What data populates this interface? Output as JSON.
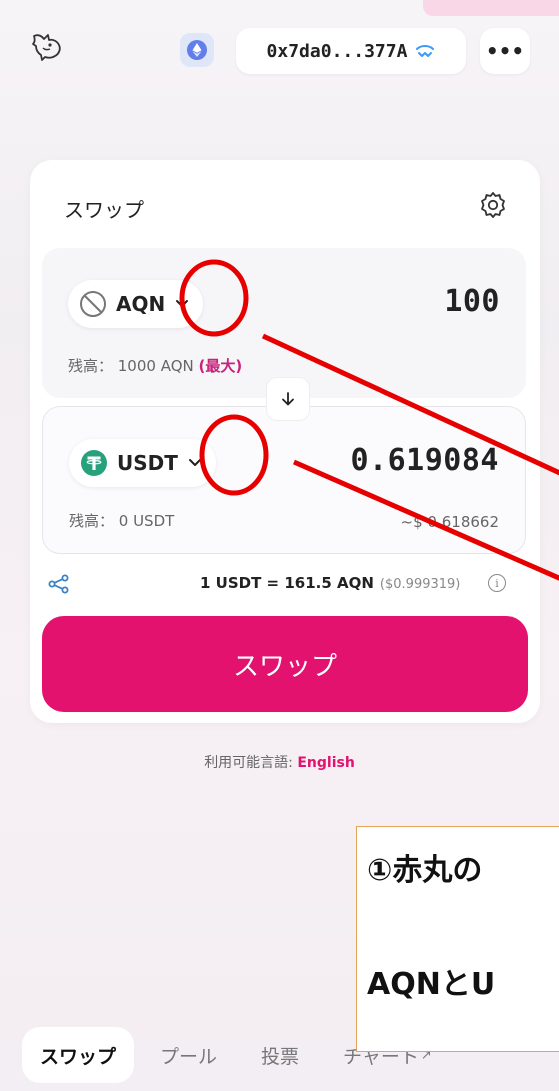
{
  "wallet": {
    "address": "0x7da0...377A"
  },
  "header": {
    "more_label": "•••"
  },
  "swap": {
    "title": "スワップ",
    "from": {
      "symbol": "AQN",
      "amount": "100",
      "balance_prefix": "残高： 1000 AQN",
      "max_label": "(最大)"
    },
    "to": {
      "symbol": "USDT",
      "amount": "0.619084",
      "balance": "残高： 0 USDT",
      "usd_value": "~$ 0.618662"
    },
    "rate": {
      "text": "1 USDT = 161.5 AQN",
      "usd": "($0.999319)"
    },
    "button_label": "スワップ"
  },
  "language": {
    "label": "利用可能言語: ",
    "link": "English"
  },
  "annotation": {
    "line1": "①赤丸の",
    "line2": "AQNとU"
  },
  "nav": {
    "tabs": [
      {
        "label": "スワップ"
      },
      {
        "label": "プール"
      },
      {
        "label": "投票"
      },
      {
        "label": "チャート"
      }
    ],
    "external_glyph": "↗"
  },
  "colors": {
    "accent": "#e3126f",
    "max_link": "#c8227a",
    "annotation_red": "#e60000",
    "tether_green": "#26a17b",
    "eth_blue": "#627eea"
  }
}
